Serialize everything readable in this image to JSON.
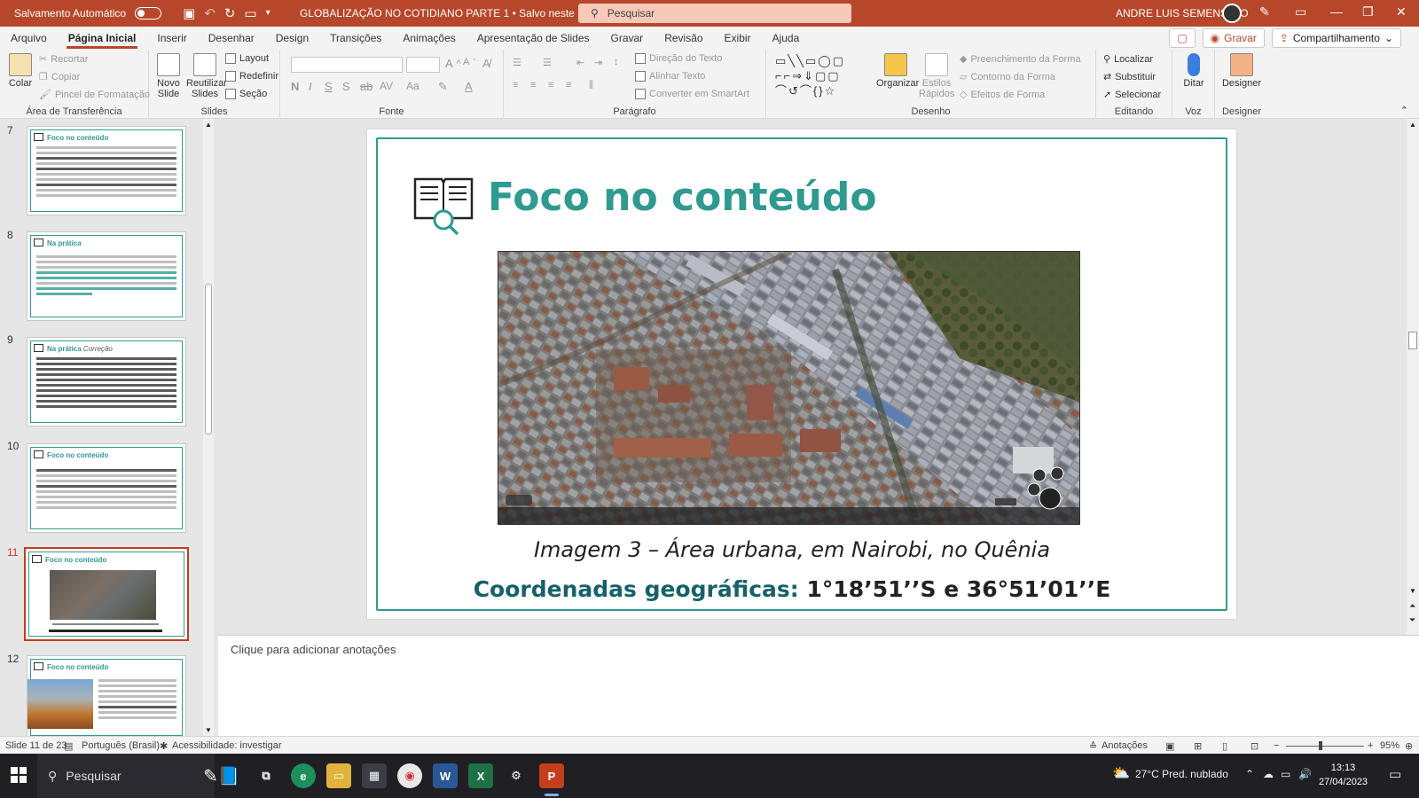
{
  "titlebar": {
    "autosave_label": "Salvamento Automático",
    "doc_title": "GLOBALIZAÇÃO NO COTIDIANO PARTE 1 • Salvo neste PC ⌄",
    "search_placeholder": "Pesquisar",
    "user_name": "ANDRE LUIS SEMENSATO"
  },
  "ribbon_tabs": [
    "Arquivo",
    "Página Inicial",
    "Inserir",
    "Desenhar",
    "Design",
    "Transições",
    "Animações",
    "Apresentação de Slides",
    "Gravar",
    "Revisão",
    "Exibir",
    "Ajuda"
  ],
  "ribbon_right": {
    "record": "Gravar",
    "share": "Compartilhamento"
  },
  "ribbon": {
    "clipboard": {
      "paste": "Colar",
      "cut": "Recortar",
      "copy": "Copiar",
      "format_painter": "Pincel de Formatação",
      "label": "Área de Transferência"
    },
    "slides": {
      "new_slide": "Novo Slide",
      "reuse_slides": "Reutilizar Slides",
      "layout": "Layout",
      "reset": "Redefinir",
      "section": "Seção",
      "label": "Slides"
    },
    "font": {
      "label": "Fonte"
    },
    "paragraph": {
      "text_direction": "Direção do Texto",
      "align_text": "Alinhar Texto",
      "smartart": "Converter em SmartArt",
      "label": "Parágrafo"
    },
    "drawing": {
      "arrange": "Organizar",
      "quick_styles": "Estilos Rápidos",
      "shape_fill": "Preenchimento da Forma",
      "shape_outline": "Contorno da Forma",
      "shape_effects": "Efeitos de Forma",
      "label": "Desenho"
    },
    "editing": {
      "find": "Localizar",
      "replace": "Substituir",
      "select": "Selecionar",
      "label": "Editando"
    },
    "voice": {
      "dictate": "Ditar",
      "label": "Voz"
    },
    "designer": {
      "designer": "Designer",
      "label": "Designer"
    }
  },
  "thumbnails": [
    {
      "num": "7",
      "title": "Foco no conteúdo",
      "subtitle": ""
    },
    {
      "num": "8",
      "title": "Na prática",
      "subtitle": ""
    },
    {
      "num": "9",
      "title": "Na prática",
      "subtitle": "Correção"
    },
    {
      "num": "10",
      "title": "Foco no conteúdo",
      "subtitle": ""
    },
    {
      "num": "11",
      "title": "Foco no conteúdo",
      "subtitle": ""
    },
    {
      "num": "12",
      "title": "Foco no conteúdo",
      "subtitle": ""
    }
  ],
  "slide": {
    "title": "Foco no conteúdo",
    "caption": "Imagem 3 – Área urbana, em Nairobi, no Quênia",
    "coords_label": "Coordenadas geográficas:",
    "coords_value": " 1°18’51’’S  e 36°51’01’’E"
  },
  "notes_placeholder": "Clique para adicionar anotações",
  "status": {
    "slide_count": "Slide 11 de 23",
    "language": "Português (Brasil)",
    "accessibility": "Acessibilidade: investigar",
    "notes": "Anotações",
    "zoom": "95%"
  },
  "taskbar": {
    "search": "Pesquisar",
    "weather": "27°C  Pred. nublado",
    "time": "13:13",
    "date": "27/04/2023"
  }
}
